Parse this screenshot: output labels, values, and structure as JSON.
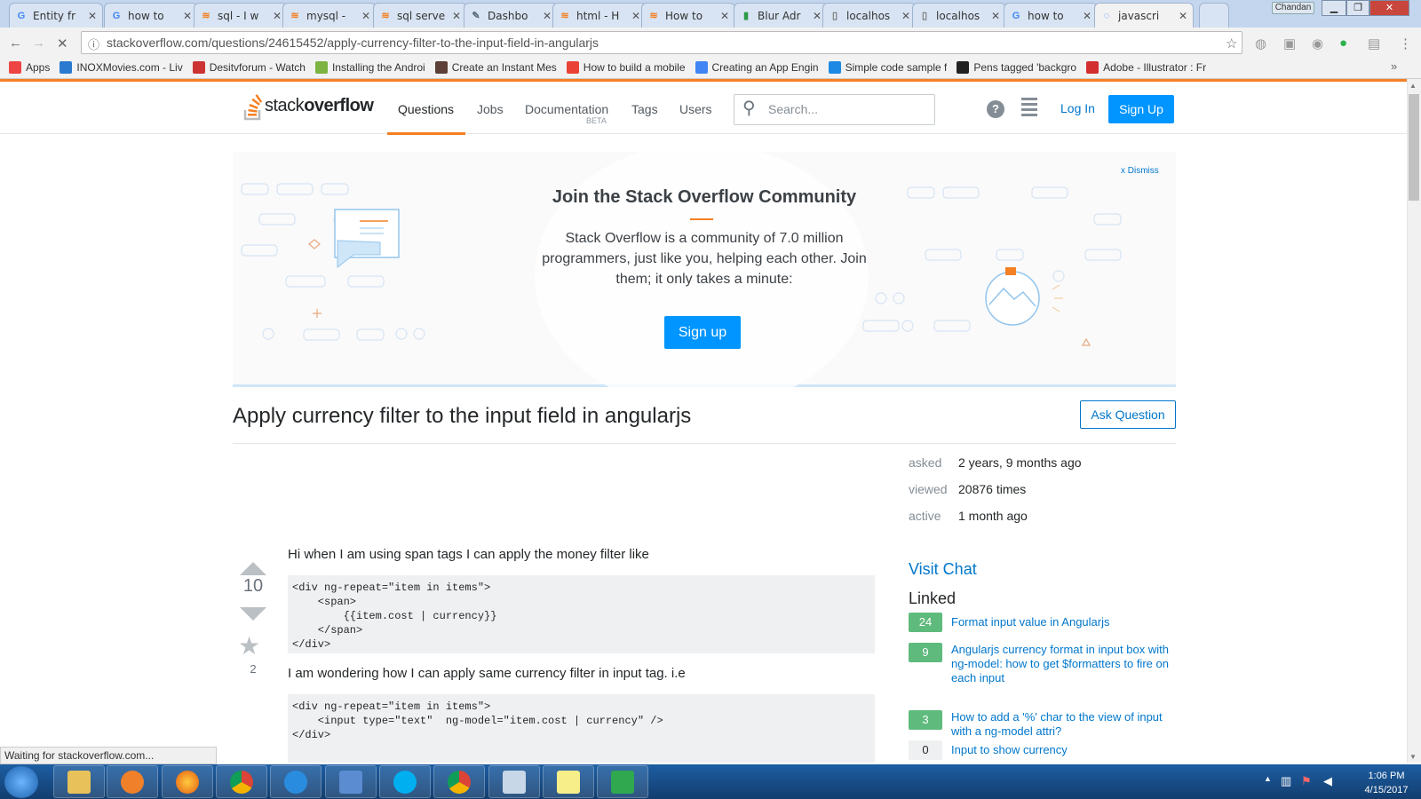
{
  "tabs": [
    {
      "title": "Entity fr",
      "color": "#4285f4",
      "glyph": "G"
    },
    {
      "title": "how to",
      "color": "#4285f4",
      "glyph": "G"
    },
    {
      "title": "sql - I w",
      "color": "#f48024",
      "glyph": "≋"
    },
    {
      "title": "mysql -",
      "color": "#f48024",
      "glyph": "≋"
    },
    {
      "title": "sql serve",
      "color": "#f48024",
      "glyph": "≋"
    },
    {
      "title": "Dashbo",
      "color": "#5a6b7b",
      "glyph": "✎"
    },
    {
      "title": "html - H",
      "color": "#f48024",
      "glyph": "≋"
    },
    {
      "title": "How to",
      "color": "#f48024",
      "glyph": "≋"
    },
    {
      "title": "Blur Adr",
      "color": "#2b9a47",
      "glyph": "▮"
    },
    {
      "title": "localhos",
      "color": "#777",
      "glyph": "▯"
    },
    {
      "title": "localhos",
      "color": "#777",
      "glyph": "▯"
    },
    {
      "title": "how to",
      "color": "#4285f4",
      "glyph": "G"
    },
    {
      "title": "javascri",
      "color": "#4285f4",
      "glyph": "◌"
    }
  ],
  "profile_name": "Chandan",
  "window": {
    "min": "▁",
    "max": "❐",
    "close": "✕"
  },
  "address": {
    "url": "stackoverflow.com/questions/24615452/apply-currency-filter-to-the-input-field-in-angularjs"
  },
  "bookmarks": [
    {
      "label": "Apps",
      "color": "#e44"
    },
    {
      "label": "INOXMovies.com - Liv",
      "color": "#2a7ad0"
    },
    {
      "label": "Desitvforum - Watch",
      "color": "#c33"
    },
    {
      "label": "Installing the Androi",
      "color": "#7cb342"
    },
    {
      "label": "Create an Instant Mes",
      "color": "#5d4037"
    },
    {
      "label": "How to build a mobile",
      "color": "#ea4335"
    },
    {
      "label": "Creating an App Engin",
      "color": "#4285f4"
    },
    {
      "label": "Simple code sample f",
      "color": "#1e88e5"
    },
    {
      "label": "Pens tagged 'backgro",
      "color": "#222"
    },
    {
      "label": "Adobe - Illustrator : Fr",
      "color": "#d32f2f"
    }
  ],
  "so": {
    "logo_a": "stack",
    "logo_b": "overflow",
    "nav": {
      "questions": "Questions",
      "jobs": "Jobs",
      "documentation": "Documentation",
      "beta": "BETA",
      "tags": "Tags",
      "users": "Users"
    },
    "search_placeholder": "Search...",
    "login": "Log In",
    "signup": "Sign Up"
  },
  "banner": {
    "dismiss": "x Dismiss",
    "title": "Join the Stack Overflow Community",
    "text": "Stack Overflow is a community of 7.0 million programmers, just like you, helping each other. Join them; it only takes a minute:",
    "signup": "Sign up"
  },
  "question": {
    "title": "Apply currency filter to the input field in angularjs",
    "ask": "Ask Question",
    "votes": "10",
    "favorites": "2",
    "p1": "Hi when I am using span tags I can apply the money filter like",
    "code1": "<div ng-repeat=\"item in items\">\n    <span>\n        {{item.cost | currency}}\n    </span>\n</div>",
    "p2": "I am wondering how I can apply same currency filter in input tag. i.e",
    "code2": "<div ng-repeat=\"item in items\">\n    <input type=\"text\"  ng-model=\"item.cost | currency\" />\n</div>"
  },
  "stats": {
    "asked_k": "asked",
    "asked_v": "2 years, 9 months ago",
    "viewed_k": "viewed",
    "viewed_v": "20876 times",
    "active_k": "active",
    "active_v": "1 month ago"
  },
  "sidebar": {
    "visit_chat": "Visit Chat",
    "linked_heading": "Linked",
    "linked": [
      {
        "count": "24",
        "title": "Format input value in Angularjs"
      },
      {
        "count": "9",
        "title": "Angularjs currency format in input box with ng-model: how to get $formatters to fire on each input"
      },
      {
        "count": "3",
        "title": "How to add a '%' char to the view of input with a ng-model attri?"
      },
      {
        "count": "0",
        "title": "Input to show currency"
      }
    ]
  },
  "status": "Waiting for stackoverflow.com...",
  "clock": {
    "time": "1:06 PM",
    "date": "4/15/2017"
  }
}
